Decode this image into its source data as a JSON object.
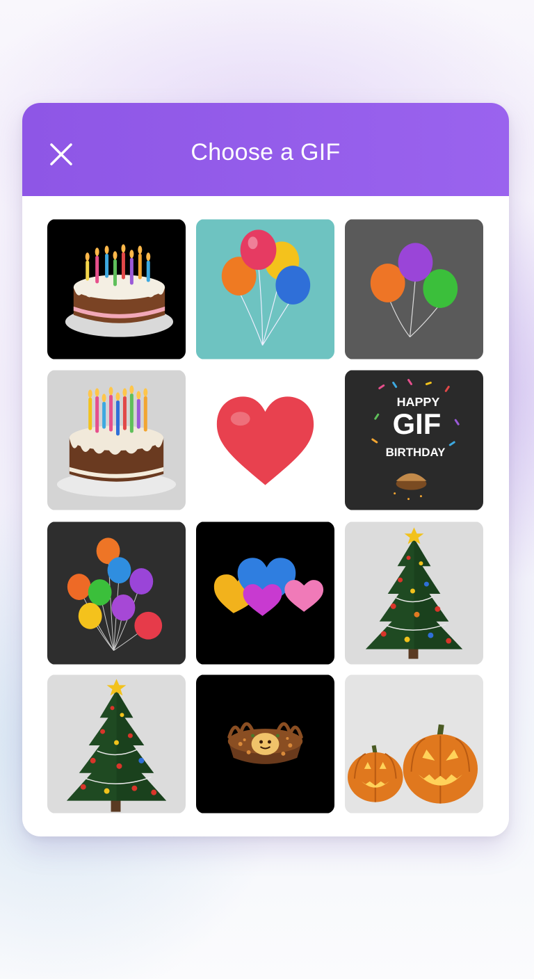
{
  "dialog": {
    "title": "Choose a GIF",
    "accent_color": "#9460EA",
    "close_icon": "close-icon"
  },
  "gifs": [
    {
      "subject": "birthday-cake",
      "background": "#000000"
    },
    {
      "subject": "balloons",
      "background": "#6ec3c1"
    },
    {
      "subject": "balloons",
      "background": "#5a5a5a"
    },
    {
      "subject": "birthday-cake",
      "background": "#d6d6d6"
    },
    {
      "subject": "heart",
      "background": "#ffffff"
    },
    {
      "subject": "happy-gif-birthday",
      "background": "#2a2a2a",
      "text": {
        "line1": "HAPPY",
        "line2": "GIF",
        "line3": "BIRTHDAY"
      }
    },
    {
      "subject": "balloons",
      "background": "#2e2e2e"
    },
    {
      "subject": "hearts",
      "background": "#000000"
    },
    {
      "subject": "christmas-tree",
      "background": "#dcdcdc"
    },
    {
      "subject": "christmas-tree",
      "background": "#dcdcdc"
    },
    {
      "subject": "food-bowl",
      "background": "#000000"
    },
    {
      "subject": "jack-o-lanterns",
      "background": "#e4e4e4"
    }
  ]
}
